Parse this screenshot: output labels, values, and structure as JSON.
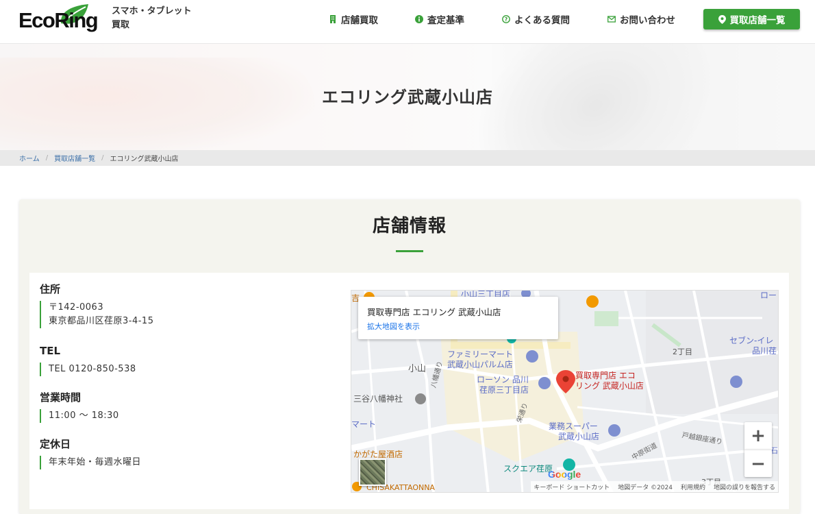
{
  "header": {
    "logo_text": "EcoRing",
    "tagline_line1": "スマホ・タブレット",
    "tagline_line2": "買取",
    "nav": [
      {
        "label": "店舗買取",
        "icon": "building-icon"
      },
      {
        "label": "査定基準",
        "icon": "info-circle-icon"
      },
      {
        "label": "よくある質問",
        "icon": "question-circle-icon"
      },
      {
        "label": "お問い合わせ",
        "icon": "envelope-icon"
      }
    ],
    "cta_label": "買取店舗一覧",
    "cta_icon": "map-pin-icon",
    "accent_color": "#3aa13a"
  },
  "hero": {
    "title": "エコリング武蔵小山店"
  },
  "breadcrumb": {
    "items": [
      "ホーム",
      "買取店舗一覧",
      "エコリング武蔵小山店"
    ]
  },
  "store": {
    "section_title": "店舗情報",
    "address_label": "住所",
    "postal_code": "〒142-0063",
    "address": "東京都品川区荏原3-4-15",
    "tel_label": "TEL",
    "tel_value": "TEL 0120-850-538",
    "hours_label": "営業時間",
    "hours_value": "11:00 〜 18:30",
    "closed_label": "定休日",
    "closed_value": "年末年始・毎週水曜日"
  },
  "map": {
    "info_name": "買取専門店 エコリング 武蔵小山店",
    "info_link": "拡大地図を表示",
    "zoom_in": "+",
    "zoom_out": "−",
    "google_logo": "Google",
    "attribution": [
      "キーボード ショートカット",
      "地図データ ©2024",
      "利用規約",
      "地図の誤りを報告する"
    ],
    "labels": {
      "top_station": "小山三丁目店",
      "top_right": "ロー",
      "top_left": "吉",
      "familymart": "ファミリーマート",
      "familymart2": "武蔵小山パルム店",
      "koyama": "小山",
      "lawson": "ローソン 品川",
      "lawson2": "荏原三丁目店",
      "pin1": "買取専門店 エコ",
      "pin2": "リング 武蔵小山店",
      "seven": "セブン-イレ",
      "seven2": "品川荏",
      "chome2": "2丁目",
      "mitani": "三谷八幡神社",
      "hachiman_st": "八幡通り",
      "sakae_st": "栄通り",
      "gyomu1": "業務スーパー",
      "gyomu2": "武蔵小山店",
      "mart": "マート",
      "kagata": "かがた屋酒店",
      "nakahara": "中原街道",
      "togoshi": "戸越銀座通り",
      "square": "スクエア荏原",
      "chome3": "3丁目",
      "chisaka": "CHISAKATTAONNA",
      "ishii": "石"
    }
  }
}
